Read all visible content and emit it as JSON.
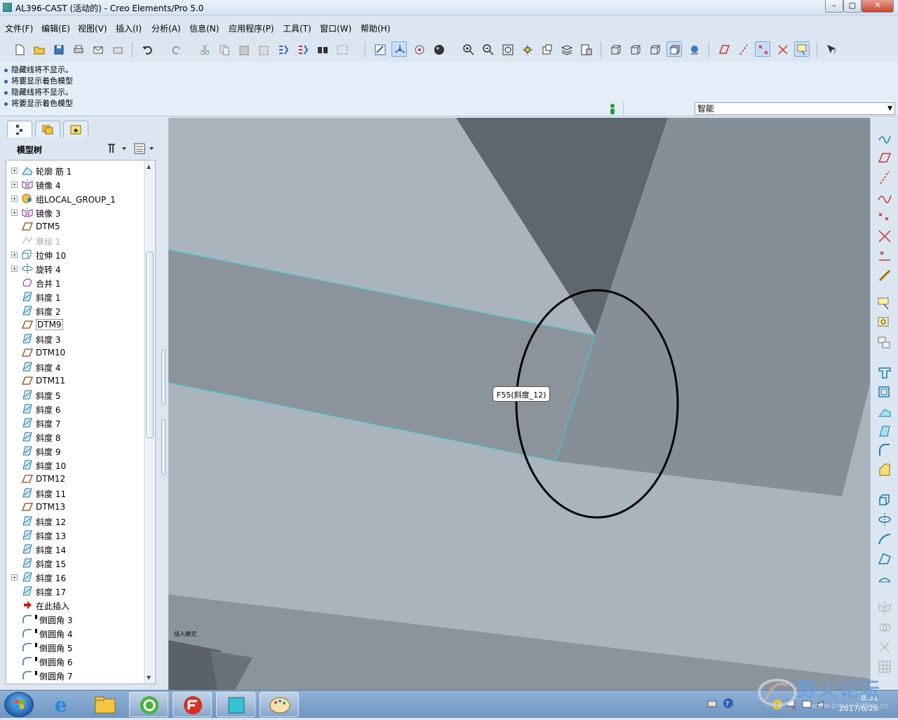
{
  "window": {
    "title": "AL396-CAST (活动的) - Creo Elements/Pro 5.0",
    "controls": [
      "–",
      "▢",
      "✕"
    ]
  },
  "menu": [
    "文件(F)",
    "编辑(E)",
    "视图(V)",
    "插入(I)",
    "分析(A)",
    "信息(N)",
    "应用程序(P)",
    "工具(T)",
    "窗口(W)",
    "帮助(H)"
  ],
  "messages": [
    "隐藏线将不显示。",
    "将要显示着色模型",
    "隐藏线将不显示。",
    "将要显示着色模型"
  ],
  "filter": {
    "value": "智能"
  },
  "model_tree": {
    "header": "模型树",
    "items": [
      {
        "label": "轮廓 筋 1",
        "expand": true,
        "icon": "rib-icon"
      },
      {
        "label": "镜像 4",
        "expand": true,
        "icon": "mirror-icon"
      },
      {
        "label": "组LOCAL_GROUP_1",
        "expand": true,
        "icon": "group-icon"
      },
      {
        "label": "镜像 3",
        "expand": true,
        "icon": "mirror-icon"
      },
      {
        "label": "DTM5",
        "expand": false,
        "icon": "datum-plane-icon"
      },
      {
        "label": "草绘 1",
        "expand": false,
        "icon": "sketch-icon",
        "dim": true
      },
      {
        "label": "拉伸 10",
        "expand": true,
        "icon": "extrude-icon"
      },
      {
        "label": "旋转 4",
        "expand": true,
        "icon": "revolve-icon"
      },
      {
        "label": "合并 1",
        "expand": false,
        "icon": "merge-icon"
      },
      {
        "label": "斜度 1",
        "expand": false,
        "icon": "draft-icon"
      },
      {
        "label": "斜度 2",
        "expand": false,
        "icon": "draft-icon"
      },
      {
        "label": "DTM9",
        "expand": false,
        "icon": "datum-plane-icon",
        "boxed": true
      },
      {
        "label": "斜度 3",
        "expand": false,
        "icon": "draft-icon"
      },
      {
        "label": "DTM10",
        "expand": false,
        "icon": "datum-plane-icon"
      },
      {
        "label": "斜度 4",
        "expand": false,
        "icon": "draft-icon"
      },
      {
        "label": "DTM11",
        "expand": false,
        "icon": "datum-plane-icon"
      },
      {
        "label": "斜度 5",
        "expand": false,
        "icon": "draft-icon"
      },
      {
        "label": "斜度 6",
        "expand": false,
        "icon": "draft-icon"
      },
      {
        "label": "斜度 7",
        "expand": false,
        "icon": "draft-icon"
      },
      {
        "label": "斜度 8",
        "expand": false,
        "icon": "draft-icon"
      },
      {
        "label": "斜度 9",
        "expand": false,
        "icon": "draft-icon"
      },
      {
        "label": "斜度 10",
        "expand": false,
        "icon": "draft-icon"
      },
      {
        "label": "DTM12",
        "expand": false,
        "icon": "datum-plane-icon"
      },
      {
        "label": "斜度 11",
        "expand": false,
        "icon": "draft-icon"
      },
      {
        "label": "DTM13",
        "expand": false,
        "icon": "datum-plane-icon"
      },
      {
        "label": "斜度 12",
        "expand": false,
        "icon": "draft-icon"
      },
      {
        "label": "斜度 13",
        "expand": false,
        "icon": "draft-icon"
      },
      {
        "label": "斜度 14",
        "expand": false,
        "icon": "draft-icon"
      },
      {
        "label": "斜度 15",
        "expand": false,
        "icon": "draft-icon"
      },
      {
        "label": "斜度 16",
        "expand": true,
        "icon": "draft-icon"
      },
      {
        "label": "斜度 17",
        "expand": false,
        "icon": "draft-icon"
      },
      {
        "label": "在此插入",
        "expand": false,
        "icon": "insert-here-arrow-icon"
      },
      {
        "label": "倒圆角 3",
        "expand": false,
        "icon": "round-icon",
        "suppressed_mark": true
      },
      {
        "label": "倒圆角 4",
        "expand": false,
        "icon": "round-icon",
        "suppressed_mark": true
      },
      {
        "label": "倒圆角 5",
        "expand": false,
        "icon": "round-icon",
        "suppressed_mark": true
      },
      {
        "label": "倒圆角 6",
        "expand": false,
        "icon": "round-icon",
        "suppressed_mark": true
      },
      {
        "label": "倒圆角 7",
        "expand": false,
        "icon": "round-icon",
        "suppressed_mark": true
      }
    ]
  },
  "viewport": {
    "tooltip": "F55(斜度_12)",
    "mode_label": "插入模式"
  },
  "taskbar": {
    "time": "8:31",
    "date": "2017/6/26"
  },
  "watermark": {
    "text": "野火论坛",
    "url": "www.proewildfire.cn"
  },
  "colors": {
    "accent": "#2b63b7",
    "edge_highlight": "#38d6e6",
    "annotation": "#000000"
  }
}
